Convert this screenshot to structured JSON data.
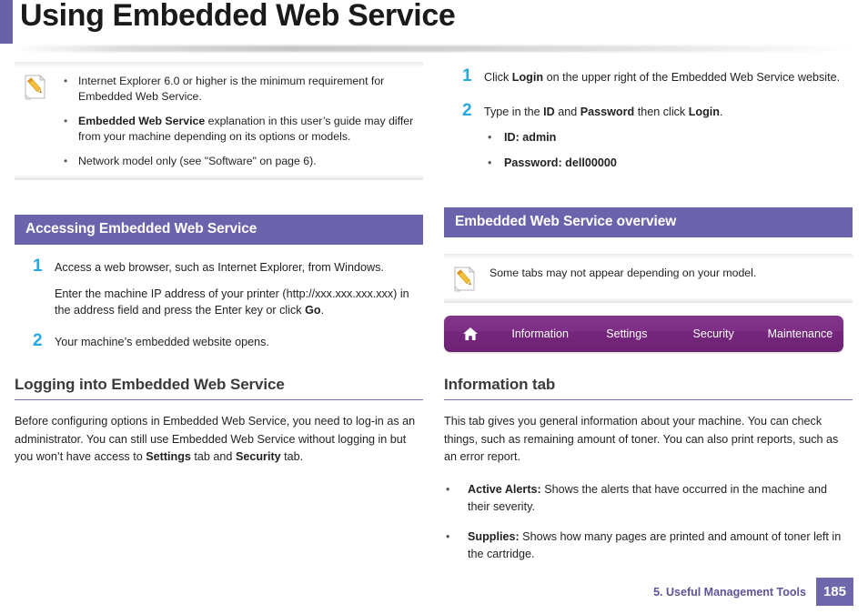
{
  "page": {
    "title": "Using Embedded Web Service",
    "accent_color": "#6a62a7",
    "heading_bar_color": "#6b63ab",
    "step_number_color": "#27a9e1",
    "ews_bar_color": "#7d2f85"
  },
  "left_column": {
    "note": {
      "icon": "note-pencil-icon",
      "items": [
        {
          "bullet": "•",
          "segments": [
            {
              "text": "Internet Explorer 6.0 or higher is the minimum requirement for ",
              "bold": false
            },
            {
              "text": "Embedded Web Service",
              "bold": false
            },
            {
              "text": ".",
              "bold": false
            }
          ],
          "plain": "Internet Explorer 6.0 or higher is the minimum requirement for Embedded Web Service."
        },
        {
          "bullet": "•",
          "segments": [
            {
              "text": "Embedded Web Service",
              "bold": true
            },
            {
              "text": " explanation in this user’s guide may differ from your machine depending on its options or models.",
              "bold": false
            }
          ],
          "plain": "Embedded Web Service explanation in this user’s guide may differ from your machine depending on its options or models."
        },
        {
          "bullet": "•",
          "segments": [
            {
              "text": "Network model only (see \"Software\" on page 6).",
              "bold": false
            }
          ],
          "plain": "Network model only (see \"Software\" on page 6)."
        }
      ]
    },
    "section_heading": "Accessing Embedded Web Service",
    "steps": [
      {
        "number": "1",
        "paragraphs": [
          [
            {
              "text": "Access a web browser, such as Internet Explorer, from Windows.",
              "bold": false
            }
          ],
          [
            {
              "text": "Enter the machine IP address of your printer (http://xxx.xxx.xxx.xxx) in the address field and press the Enter key or click ",
              "bold": false
            },
            {
              "text": "Go",
              "bold": true
            },
            {
              "text": ".",
              "bold": false
            }
          ]
        ]
      },
      {
        "number": "2",
        "paragraphs": [
          [
            {
              "text": "Your machine’s embedded website opens.",
              "bold": false
            }
          ]
        ]
      }
    ],
    "sub_heading": "Logging into Embedded Web Service",
    "paragraph": [
      {
        "text": "Before configuring options in Embedded Web Service, you need to log-in as an administrator. You can still use Embedded Web Service without logging in but you won’t have access to ",
        "bold": false
      },
      {
        "text": "Settings",
        "bold": true
      },
      {
        "text": " tab and ",
        "bold": false
      },
      {
        "text": "Security",
        "bold": true
      },
      {
        "text": " tab.",
        "bold": false
      }
    ]
  },
  "right_column": {
    "steps": [
      {
        "number": "1",
        "paragraphs": [
          [
            {
              "text": "Click ",
              "bold": false
            },
            {
              "text": "Login",
              "bold": true
            },
            {
              "text": " on the upper right of the Embedded Web Service website.",
              "bold": false
            }
          ]
        ],
        "sub_items": []
      },
      {
        "number": "2",
        "paragraphs": [
          [
            {
              "text": "Type in the ",
              "bold": false
            },
            {
              "text": "ID",
              "bold": true
            },
            {
              "text": " and ",
              "bold": false
            },
            {
              "text": "Password",
              "bold": true
            },
            {
              "text": " then click ",
              "bold": false
            },
            {
              "text": "Login",
              "bold": true
            },
            {
              "text": ".",
              "bold": false
            }
          ]
        ],
        "sub_items": [
          {
            "bullet": "•",
            "text": "ID: admin"
          },
          {
            "bullet": "•",
            "text": "Password: dell00000"
          }
        ]
      }
    ],
    "section_heading": "Embedded Web Service overview",
    "note": {
      "icon": "note-pencil-icon",
      "text": "Some tabs may not appear depending on your model."
    },
    "ews_bar": {
      "home_icon": "home-icon",
      "tabs": [
        {
          "label": "Information"
        },
        {
          "label": "Settings"
        },
        {
          "label": "Security"
        },
        {
          "label": "Maintenance"
        }
      ]
    },
    "sub_heading": "Information tab",
    "paragraph": [
      {
        "text": "This tab gives you general information about your machine. You can check things, such as remaining amount of toner. You can also print reports, such as an error report.",
        "bold": false
      }
    ],
    "info_list": [
      {
        "bullet": "•",
        "segments": [
          {
            "text": "Active Alerts:",
            "bold": true
          },
          {
            "text": " Shows the alerts that have occurred in the machine and their severity.",
            "bold": false
          }
        ]
      },
      {
        "bullet": "•",
        "segments": [
          {
            "text": "Supplies:",
            "bold": true
          },
          {
            "text": " Shows how many pages are printed and amount of toner left in the cartridge.",
            "bold": false
          }
        ]
      }
    ]
  },
  "footer": {
    "label": "5.  Useful Management Tools",
    "page_number": "185"
  }
}
